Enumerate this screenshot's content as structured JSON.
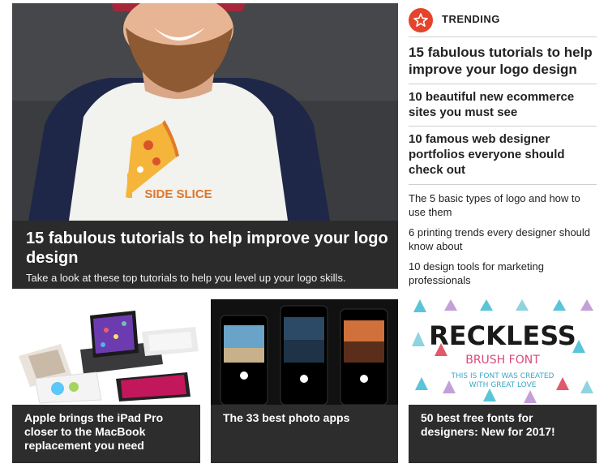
{
  "hero": {
    "image_label": "SIDE SLICE",
    "title": "15 fabulous tutorials to help improve your logo design",
    "description": "Take a look at these top tutorials to help you level up your logo skills."
  },
  "trending": {
    "heading": "TRENDING",
    "icon": "star-icon",
    "accent_color": "#e3442b",
    "items": [
      {
        "label": "15 fabulous tutorials to help improve your logo design"
      },
      {
        "label": "10 beautiful new ecommerce sites you must see"
      },
      {
        "label": "10 famous web designer portfolios everyone should check out"
      },
      {
        "label": "The 5 basic types of logo and how to use them"
      },
      {
        "label": "6 printing trends every designer should know about"
      },
      {
        "label": "10 design tools for marketing professionals"
      }
    ]
  },
  "cards": [
    {
      "title": "Apple brings the iPad Pro closer to the MacBook replacement you need"
    },
    {
      "title": "The 33 best photo apps"
    },
    {
      "title": "50 best free fonts for designers: New for 2017!",
      "image_text": [
        "RECKLESS",
        "BRUSH FONT",
        "THIS IS FONT WAS CREATED",
        "WITH GREAT LOVE"
      ]
    }
  ]
}
